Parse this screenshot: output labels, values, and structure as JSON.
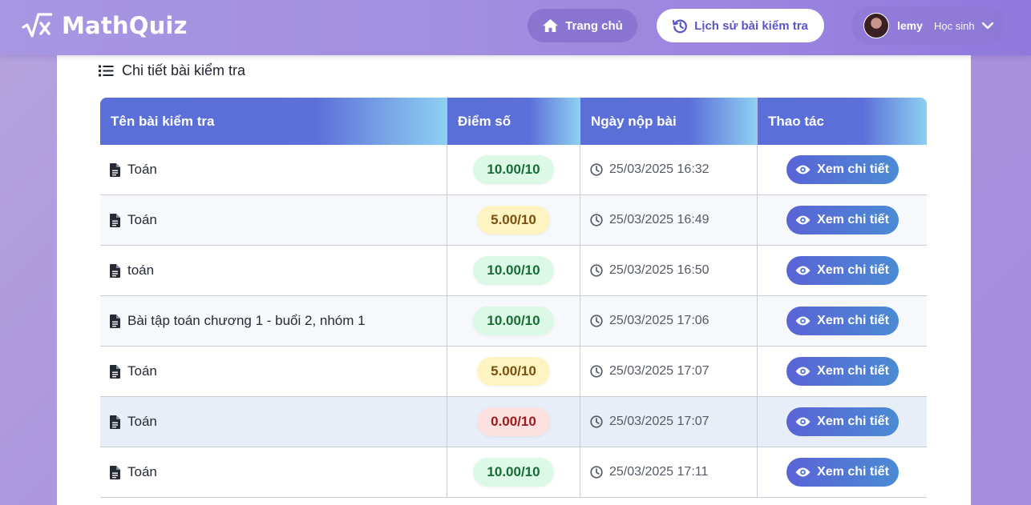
{
  "header": {
    "brand_name": "MathQuiz",
    "brand_icon": "sqrt-x-icon",
    "nav": {
      "home_label": "Trang chủ",
      "home_icon": "home-icon",
      "history_label": "Lịch sử bài kiểm tra",
      "history_icon": "history-icon"
    },
    "user": {
      "name": "lemy",
      "role": "Học sinh",
      "avatar_icon": "avatar-photo",
      "dropdown_icon": "chevron-down-icon"
    }
  },
  "section": {
    "title": "Chi tiết bài kiểm tra",
    "icon": "list-icon"
  },
  "table": {
    "columns": [
      "Tên bài kiểm tra",
      "Điểm số",
      "Ngày nộp bài",
      "Thao tác"
    ],
    "action_label": "Xem chi tiết",
    "rows": [
      {
        "name": "Toán",
        "score": "10.00/10",
        "level": "green",
        "date": "25/03/2025 16:32"
      },
      {
        "name": "Toán",
        "score": "5.00/10",
        "level": "yellow",
        "date": "25/03/2025 16:49"
      },
      {
        "name": "toán",
        "score": "10.00/10",
        "level": "green",
        "date": "25/03/2025 16:50"
      },
      {
        "name": "Bài tập toán chương 1 - buổi 2, nhóm 1",
        "score": "10.00/10",
        "level": "green",
        "date": "25/03/2025 17:06"
      },
      {
        "name": "Toán",
        "score": "5.00/10",
        "level": "yellow",
        "date": "25/03/2025 17:07"
      },
      {
        "name": "Toán",
        "score": "0.00/10",
        "level": "red",
        "date": "25/03/2025 17:07"
      },
      {
        "name": "Toán",
        "score": "10.00/10",
        "level": "green",
        "date": "25/03/2025 17:11"
      }
    ]
  },
  "colors": {
    "accent": "#5a63d6",
    "header_gradient_start": "#a796e2",
    "score_good": "#dcf8e6",
    "score_mid": "#fdf4c2",
    "score_bad": "#fde0e0"
  }
}
